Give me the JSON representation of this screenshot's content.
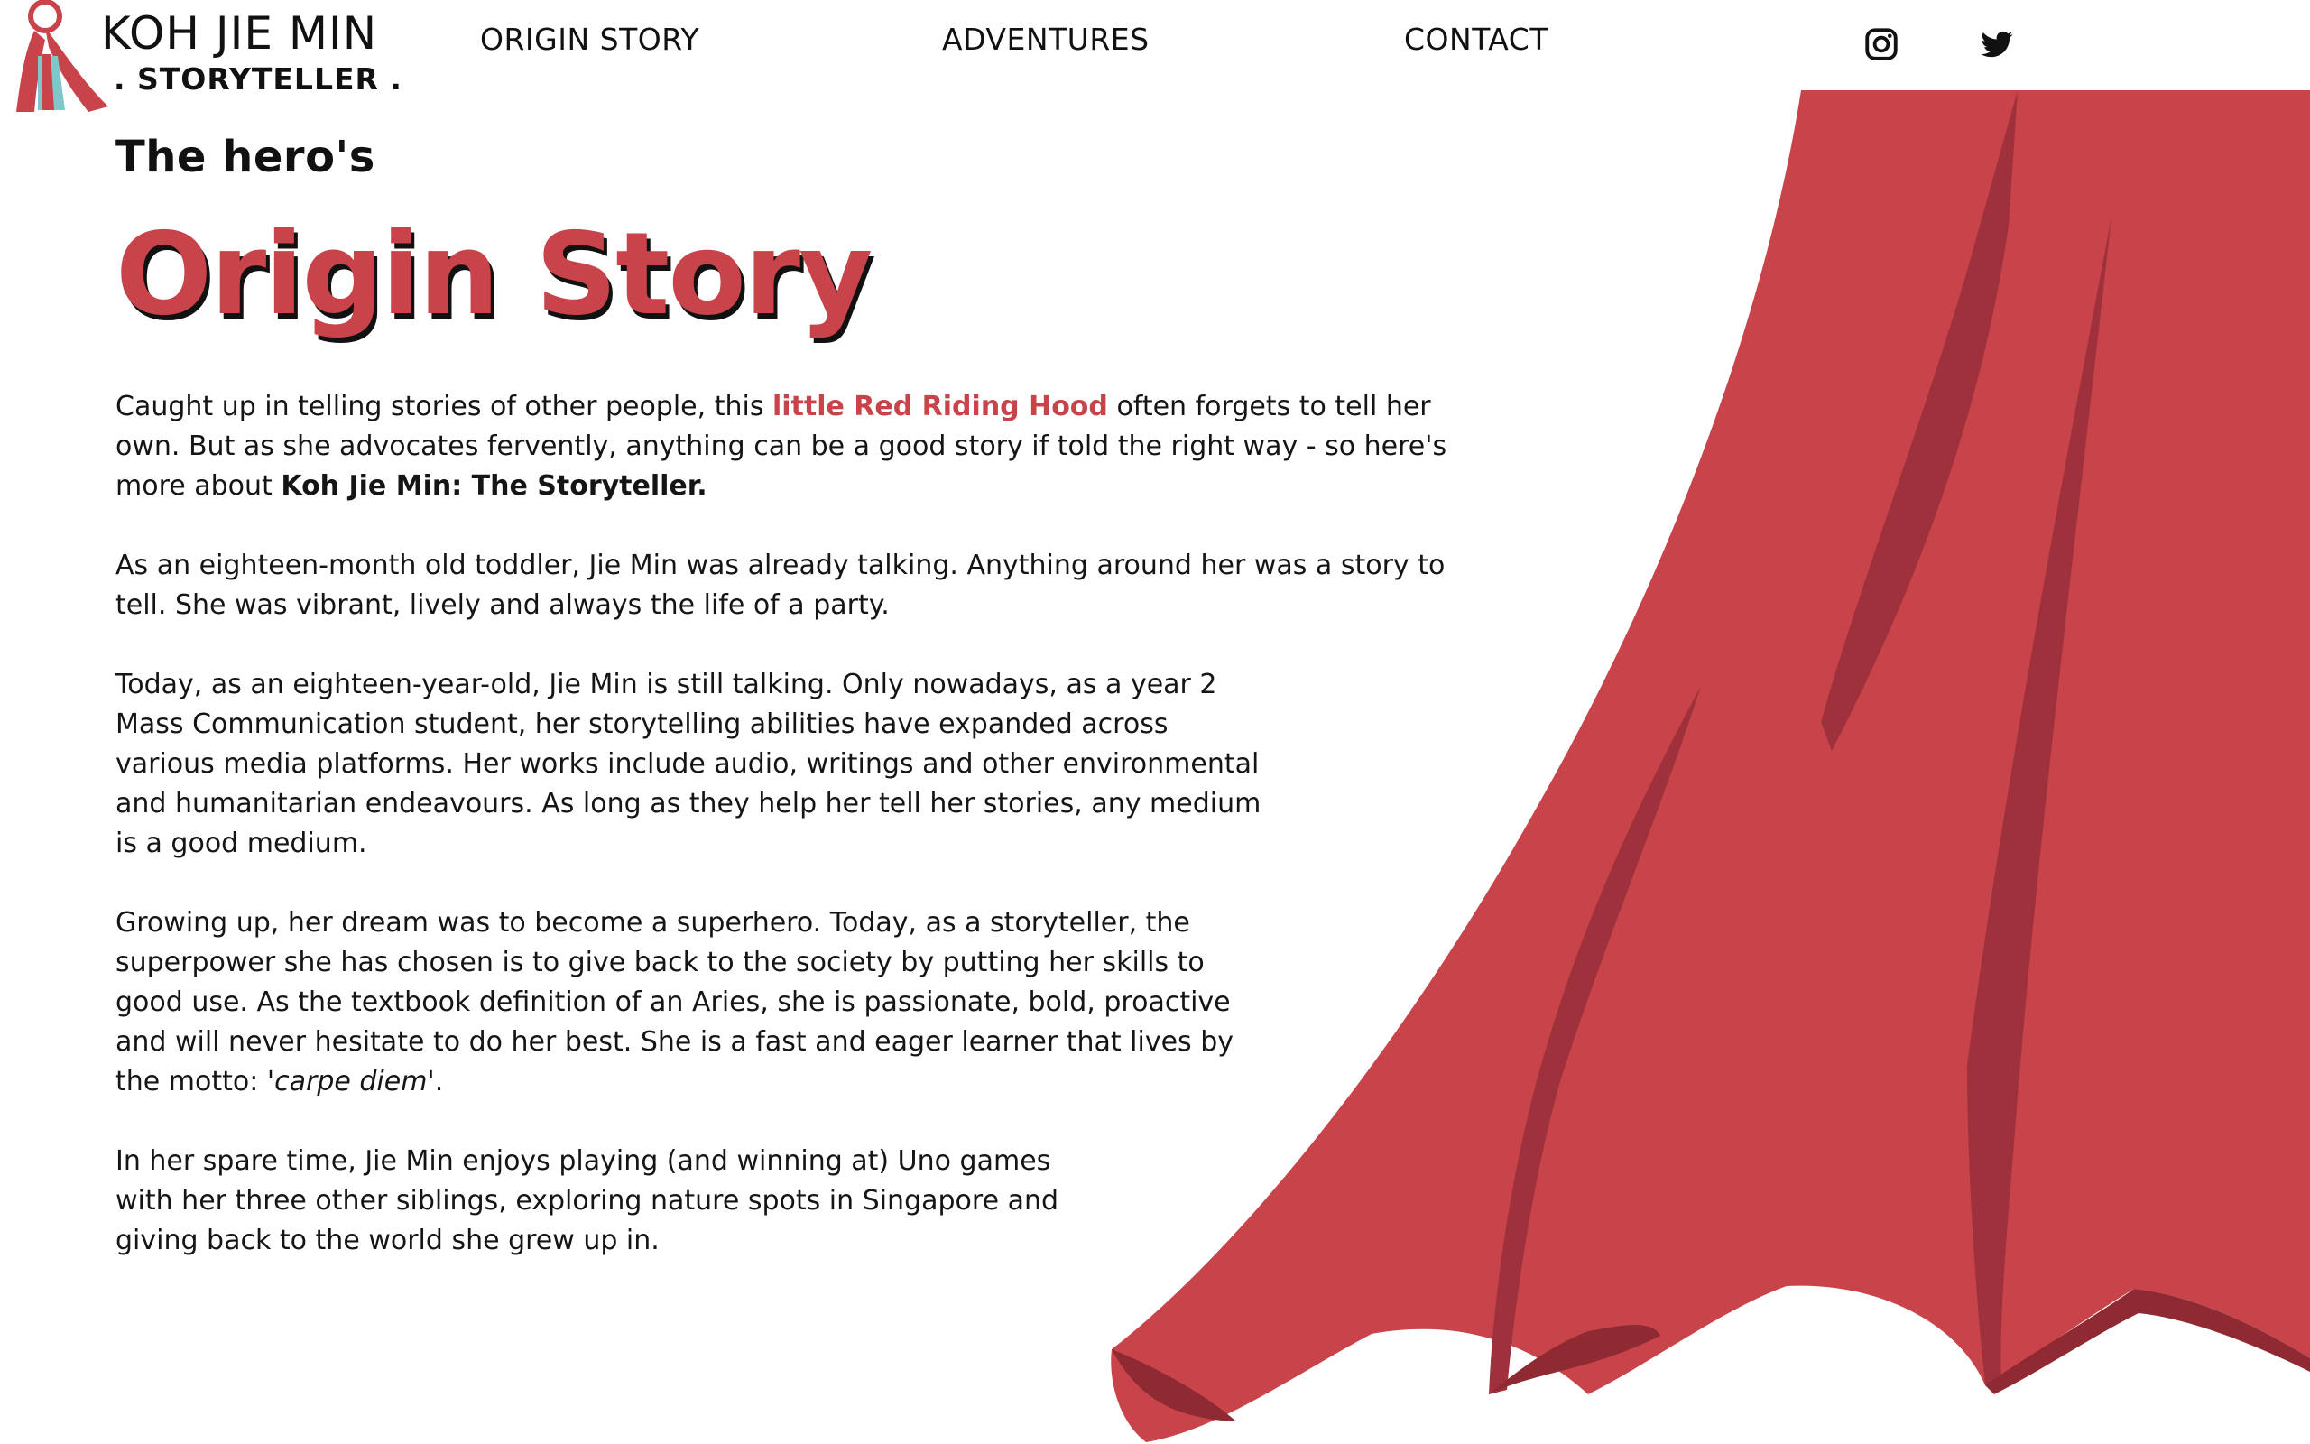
{
  "header": {
    "brand_name": "KOH JIE MIN",
    "brand_tagline": ". STORYTELLER .",
    "logo_icon": "red-hood-figure-icon",
    "nav": [
      {
        "label": "ORIGIN STORY"
      },
      {
        "label": "ADVENTURES"
      },
      {
        "label": "CONTACT"
      }
    ],
    "social": [
      {
        "icon": "instagram-icon"
      },
      {
        "icon": "twitter-icon"
      }
    ]
  },
  "hero": {
    "kicker": "The hero's",
    "title": "Origin Story"
  },
  "paragraphs": {
    "p1": {
      "before": "Caught up in telling stories of other people, this ",
      "highlight": "little Red Riding Hood",
      "after": " often forgets to tell her own. But as she advocates fervently, anything can be a good story if told the right way - so here's more about ",
      "strong": "Koh Jie Min: The Storyteller."
    },
    "p2": "As an eighteen-month old toddler, Jie Min was already talking. Anything around her was a story to tell. She was vibrant, lively and always the life of a party.",
    "p3": "Today, as an eighteen-year-old, Jie Min is still talking. Only nowadays, as a year 2 Mass Communication student, her storytelling abilities have expanded across various media platforms. Her works include audio, writings and other environmental and humanitarian endeavours. As long as they help her tell her stories, any medium is a good medium.",
    "p4": {
      "text": "Growing up, her dream was to become a superhero. Today, as a storyteller, the superpower she has chosen is to give back to the society by putting her skills to good use. As the textbook definition of an Aries, she is passionate, bold, proactive and will never hesitate to do her best. She is a fast and eager learner that lives by the motto: ",
      "motto": "'carpe diem'",
      "end": "."
    },
    "p5": "In her spare time, Jie Min enjoys playing (and winning at) Uno games with her three other siblings, exploring nature spots in Singapore and giving back to the world she grew up in."
  },
  "colors": {
    "accent": "#c8444a",
    "cape": "#c8444a",
    "cape_shadow": "#9e313b",
    "logo_teal": "#7fc7c9"
  }
}
